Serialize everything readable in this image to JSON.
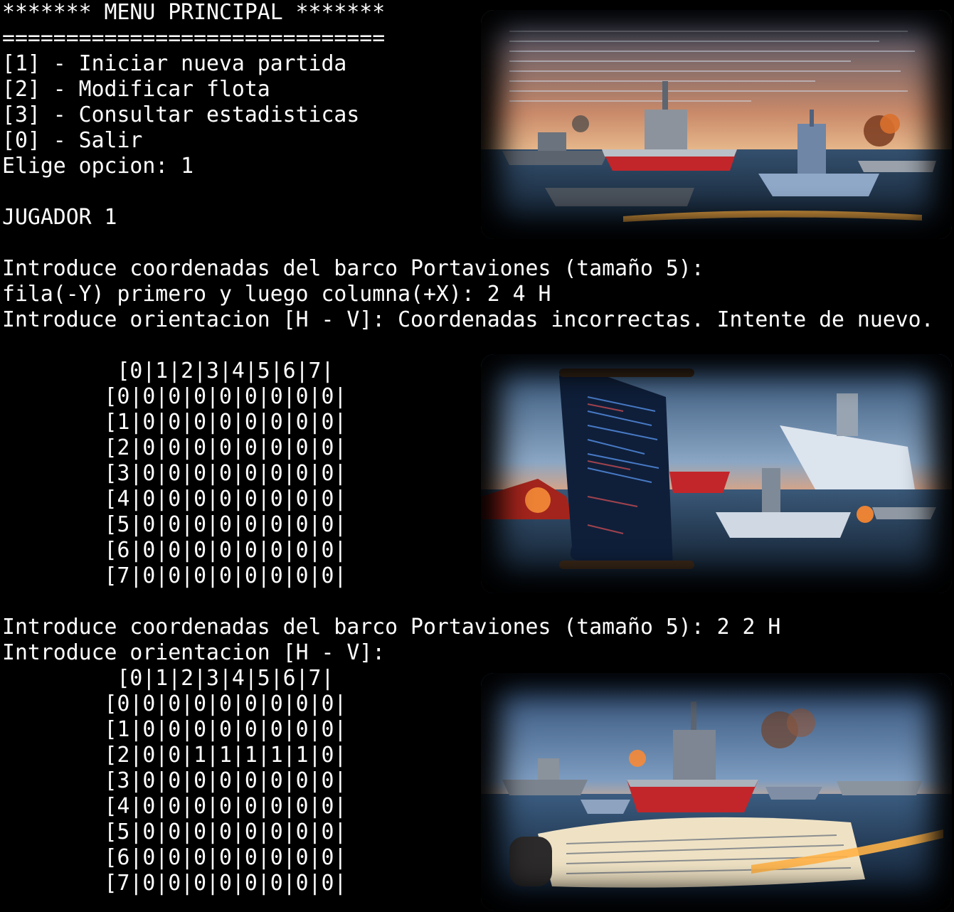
{
  "menu": {
    "title": "******* MENU PRINCIPAL *******",
    "separator": "==============================",
    "options": [
      "[1] - Iniciar nueva partida",
      "[2] - Modificar flota",
      "[3] - Consultar estadisticas",
      "[0] - Salir"
    ],
    "prompt": "Elige opcion: 1"
  },
  "player": {
    "label": "JUGADOR 1"
  },
  "attempt1": {
    "coords_prompt": "Introduce coordenadas del barco Portaviones (tamaño 5):",
    "coords_input": "fila(-Y) primero y luego columna(+X): 2 4 H",
    "orientation_prompt": "Introduce orientacion [H - V]: Coordenadas incorrectas. Intente de nuevo."
  },
  "board1": {
    "header": "[0|1|2|3|4|5|6|7|",
    "rows": [
      "[0|0|0|0|0|0|0|0|0|",
      "[1|0|0|0|0|0|0|0|0|",
      "[2|0|0|0|0|0|0|0|0|",
      "[3|0|0|0|0|0|0|0|0|",
      "[4|0|0|0|0|0|0|0|0|",
      "[5|0|0|0|0|0|0|0|0|",
      "[6|0|0|0|0|0|0|0|0|",
      "[7|0|0|0|0|0|0|0|0|"
    ]
  },
  "attempt2": {
    "coords_prompt": "Introduce coordenadas del barco Portaviones (tamaño 5): 2 2 H",
    "orientation_prompt": "Introduce orientacion [H - V]:"
  },
  "board2": {
    "header": "[0|1|2|3|4|5|6|7|",
    "rows": [
      "[0|0|0|0|0|0|0|0|0|",
      "[1|0|0|0|0|0|0|0|0|",
      "[2|0|0|1|1|1|1|1|0|",
      "[3|0|0|0|0|0|0|0|0|",
      "[4|0|0|0|0|0|0|0|0|",
      "[5|0|0|0|0|0|0|0|0|",
      "[6|0|0|0|0|0|0|0|0|",
      "[7|0|0|0|0|0|0|0|0|"
    ]
  },
  "colors": {
    "background": "#000000",
    "text": "#ffffff"
  }
}
